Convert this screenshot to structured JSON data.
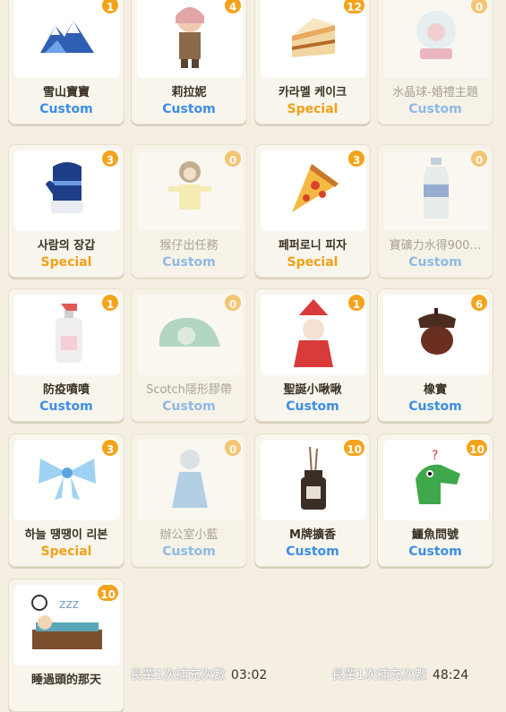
{
  "items": [
    {
      "name": "雪山寶寶",
      "type": "Custom",
      "count": "1",
      "icon": "snow-mountain-icon",
      "dim": false
    },
    {
      "name": "莉拉妮",
      "type": "Custom",
      "count": "4",
      "icon": "girl-character-icon",
      "dim": false
    },
    {
      "name": "카라멜 케이크",
      "type": "Special",
      "count": "12",
      "icon": "cake-slice-icon",
      "dim": false
    },
    {
      "name": "水晶球-婚禮主題",
      "type": "Custom",
      "count": "0",
      "icon": "snow-globe-icon",
      "dim": true
    },
    {
      "name": "사람의 장갑",
      "type": "Special",
      "count": "3",
      "icon": "mitten-icon",
      "dim": false
    },
    {
      "name": "猴仔出任務",
      "type": "Custom",
      "count": "0",
      "icon": "monkey-icon",
      "dim": true
    },
    {
      "name": "페퍼로니 피자",
      "type": "Special",
      "count": "3",
      "icon": "pizza-slice-icon",
      "dim": false
    },
    {
      "name": "寶礦力水得900…",
      "type": "Custom",
      "count": "0",
      "icon": "water-bottle-icon",
      "dim": true
    },
    {
      "name": "防疫噴噴",
      "type": "Custom",
      "count": "1",
      "icon": "spray-bottle-icon",
      "dim": false
    },
    {
      "name": "Scotch隱形膠帶",
      "type": "Custom",
      "count": "0",
      "icon": "tape-dispenser-icon",
      "dim": true
    },
    {
      "name": "聖誕小啾啾",
      "type": "Custom",
      "count": "1",
      "icon": "santa-character-icon",
      "dim": false
    },
    {
      "name": "橡實",
      "type": "Custom",
      "count": "6",
      "icon": "acorn-icon",
      "dim": false
    },
    {
      "name": "하늘 땡땡이 리본",
      "type": "Special",
      "count": "3",
      "icon": "ribbon-bow-icon",
      "dim": false
    },
    {
      "name": "辦公室小藍",
      "type": "Custom",
      "count": "0",
      "icon": "office-character-icon",
      "dim": true
    },
    {
      "name": "M牌擴香",
      "type": "Custom",
      "count": "10",
      "icon": "diffuser-icon",
      "dim": false
    },
    {
      "name": "鱷魚問號",
      "type": "Custom",
      "count": "10",
      "icon": "crocodile-icon",
      "dim": false
    },
    {
      "name": "睡過頭的那天",
      "type": "",
      "count": "10",
      "icon": "sleeping-icon",
      "dim": false
    }
  ],
  "tickers": [
    {
      "text": "長輩1次補充次數",
      "time": "03:02"
    },
    {
      "text": "長輩1次補充次數",
      "time": "48:24"
    }
  ]
}
